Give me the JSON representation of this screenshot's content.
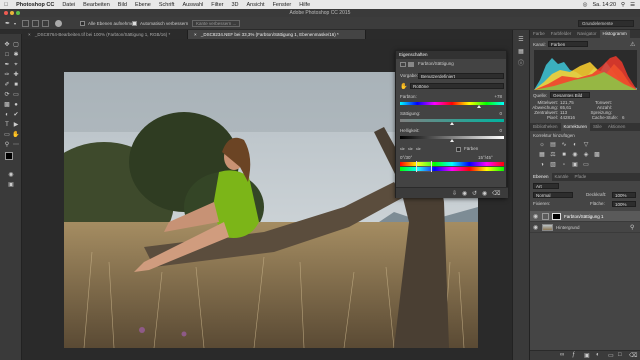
{
  "menubar": {
    "app_name": "Photoshop CC",
    "items": [
      "Datei",
      "Bearbeiten",
      "Bild",
      "Ebene",
      "Schrift",
      "Auswahl",
      "Filter",
      "3D",
      "Ansicht",
      "Fenster",
      "Hilfe"
    ],
    "clock": "Sa. 14:20"
  },
  "window": {
    "title": "Adobe Photoshop CC 2015"
  },
  "options_bar": {
    "sample_all_layers": "Alle Ebenen aufnehmen",
    "auto_enhance": "Automatisch verbessern",
    "refine_edge": "Kante verbessern ...",
    "workspace": "Grundelemente"
  },
  "document_tabs": [
    {
      "label": "_DSC8764-Bearbeiten.tif bei 100% (Farbton/Sättigung 1, RGB/16) *"
    },
    {
      "label": "_DSC8234.NEF bei 33,3% (Farbton/Sättigung 1, Ebenenmaske/16) *"
    }
  ],
  "properties_panel": {
    "title": "Eigenschaften",
    "subtitle": "Farbton/Sättigung",
    "preset_label": "Vorgabe:",
    "preset_value": "Benutzerdefiniert",
    "channel_value": "Rottöne",
    "hue_label": "Farbton:",
    "hue_value": "+78",
    "hue_pos": 0.76,
    "sat_label": "Sättigung:",
    "sat_value": "0",
    "sat_pos": 0.5,
    "light_label": "Helligkeit:",
    "light_value": "0",
    "light_pos": 0.5,
    "colorize_label": "Färben",
    "range_left": "0°/30°",
    "range_right": "15°/45°"
  },
  "right_panel": {
    "top_tabs": [
      "Farbe",
      "Farbfelder",
      "Navigator",
      "Histogramm"
    ],
    "top_active": 3,
    "channel_label": "Kanal:",
    "channel_value": "Farben",
    "stats": {
      "source_label": "Quelle:",
      "source_value": "Gesamtes Bild",
      "mean_label": "Mittelwert:",
      "mean_value": "121,75",
      "std_label": "Abweichung:",
      "std_value": "65,61",
      "median_label": "Zentralwert:",
      "median_value": "113",
      "pixels_label": "Pixel:",
      "pixels_value": "442816",
      "level_label": "Tonwert:",
      "count_label": "Anzahl:",
      "percent_label": "Spreizung:",
      "cache_label": "Cache-Stufe:",
      "cache_value": "6"
    },
    "mid_tabs": [
      "Bibliotheken",
      "Korrekturen",
      "Stile",
      "Aktionen"
    ],
    "mid_active": 1,
    "adjust_label": "Korrektur hinzufügen",
    "layer_tabs": [
      "Ebenen",
      "Kanäle",
      "Pfade"
    ],
    "layer_active": 0,
    "kind_label": "Art",
    "blend_mode": "Normal",
    "opacity_label": "Deckkraft:",
    "opacity_value": "100%",
    "fill_label": "Fläche:",
    "fill_value": "100%",
    "lock_label": "Fixieren:",
    "layers": [
      {
        "name": "Farbton/Sättigung 1",
        "selected": true
      },
      {
        "name": "Hintergrund",
        "selected": false
      }
    ]
  },
  "colors": {
    "accent": "#9bc53d",
    "dress": "#7cb518",
    "sky": "#c8cfd3"
  }
}
